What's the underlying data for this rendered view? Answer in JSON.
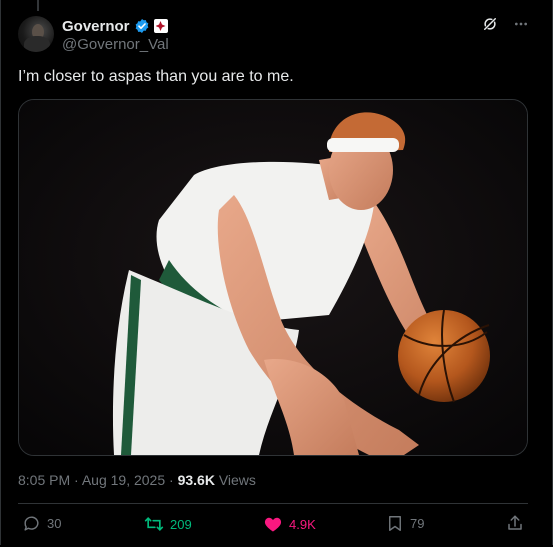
{
  "author": {
    "name": "Governor",
    "handle": "@Governor_Val"
  },
  "tweet": {
    "text": "I’m closer to aspas than you are to me."
  },
  "meta": {
    "time": "8:05 PM",
    "date": "Aug 19, 2025",
    "separator": "·",
    "views_count": "93.6K",
    "views_label": "Views"
  },
  "actions": {
    "replies": "30",
    "reposts": "209",
    "likes": "4.9K",
    "bookmarks": "79"
  },
  "colors": {
    "verified": "#1d9bf0",
    "repost": "#00ba7c",
    "like": "#f91880",
    "muted": "#71767b"
  },
  "icons": [
    "verified-icon",
    "affiliate-badge-icon",
    "grok-icon",
    "more-icon",
    "reply-icon",
    "repost-icon",
    "like-icon",
    "bookmark-icon",
    "share-icon"
  ]
}
